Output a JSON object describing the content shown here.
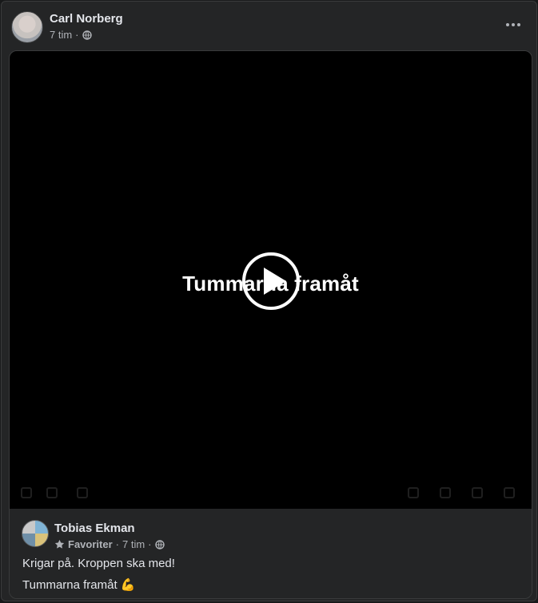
{
  "post": {
    "author": "Carl Norberg",
    "time": "7 tim",
    "separator": "·",
    "privacy_icon": "globe-icon",
    "more_icon": "more-options-icon"
  },
  "video": {
    "title": "Tummarna framåt",
    "play_icon": "play-icon"
  },
  "shared": {
    "author": "Tobias Ekman",
    "favorites_label": "Favoriter",
    "time": "7 tim",
    "separator": "·",
    "line1": "Krigar på. Kroppen ska med!",
    "line2": "Tummarna framåt 💪"
  }
}
